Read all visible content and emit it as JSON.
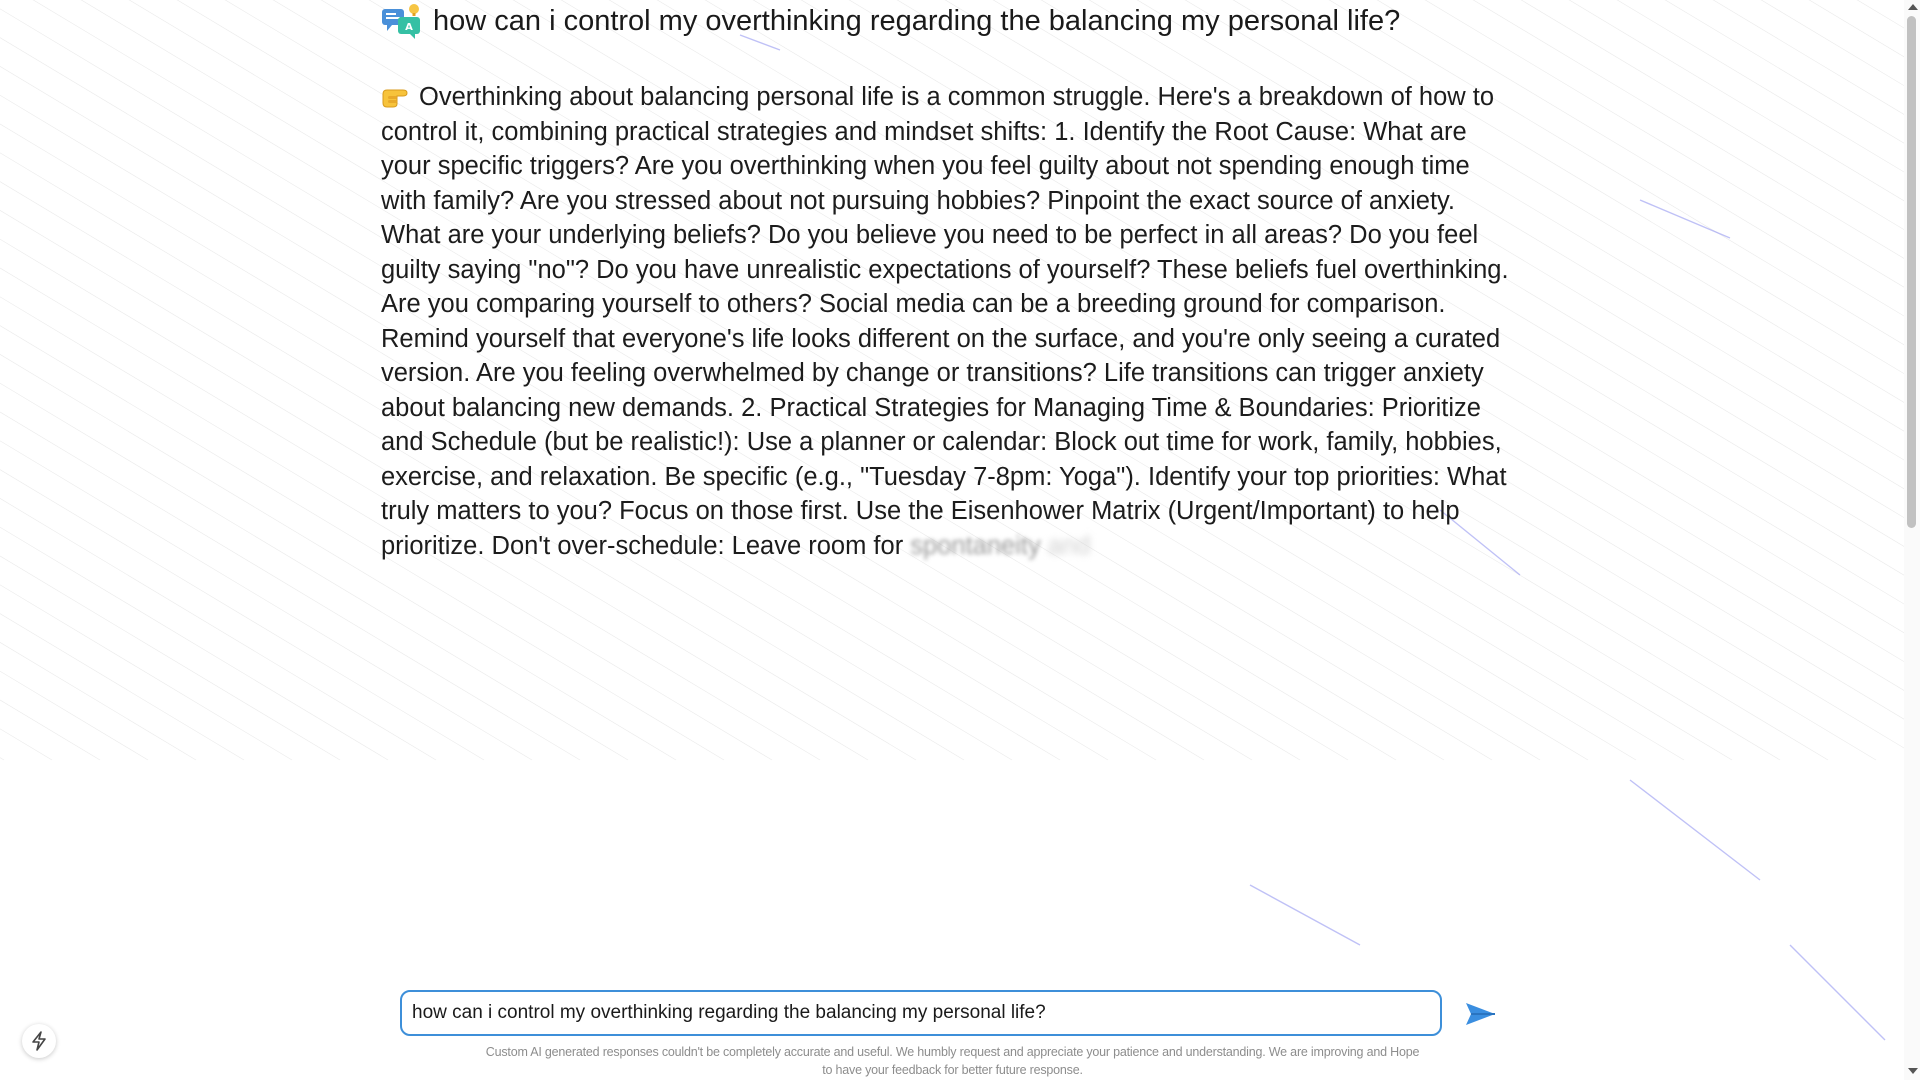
{
  "question": {
    "icon": "chat-translate-icon",
    "text": "how can i control my overthinking regarding the balancing my personal life?"
  },
  "answer": {
    "icon": "pointing-hand-icon",
    "text": "Overthinking about balancing personal life is a common struggle. Here's a breakdown of how to control it, combining practical strategies and mindset shifts: 1. Identify the Root Cause: What are your specific triggers? Are you overthinking when you feel guilty about not spending enough time with family? Are you stressed about not pursuing hobbies? Pinpoint the exact source of anxiety. What are your underlying beliefs? Do you believe you need to be perfect in all areas? Do you feel guilty saying \"no\"? Do you have unrealistic expectations of yourself? These beliefs fuel overthinking. Are you comparing yourself to others? Social media can be a breeding ground for comparison. Remind yourself that everyone's life looks different on the surface, and you're only seeing a curated version. Are you feeling overwhelmed by change or transitions? Life transitions can trigger anxiety about balancing new demands. 2. Practical Strategies for Managing Time & Boundaries: Prioritize and Schedule (but be realistic!): Use a planner or calendar: Block out time for work, family, hobbies, exercise, and relaxation. Be specific (e.g., \"Tuesday 7-8pm: Yoga\"). Identify your top priorities: What truly matters to you? Focus on those first. Use the Eisenhower Matrix (Urgent/Important) to help prioritize. Don't over-schedule: Leave room for",
    "streaming_word": "spontaneity",
    "streaming_tail": "and"
  },
  "input": {
    "value": "how can i control my overthinking regarding the balancing my personal life?"
  },
  "send_button": {
    "icon": "send-arrow-icon",
    "color": "#3a8ee0"
  },
  "disclaimer": {
    "line1": "Custom AI generated responses couldn't be completely accurate and useful. We humbly request and appreciate your patience and understanding. We are improving and Hope",
    "line2": "to have your feedback for better future response."
  },
  "bolt_button": {
    "icon": "lightning-bolt-icon"
  },
  "colors": {
    "accent": "#3d8fd9",
    "text": "#1c1c1c",
    "disclaimer": "#8d8d8d"
  }
}
